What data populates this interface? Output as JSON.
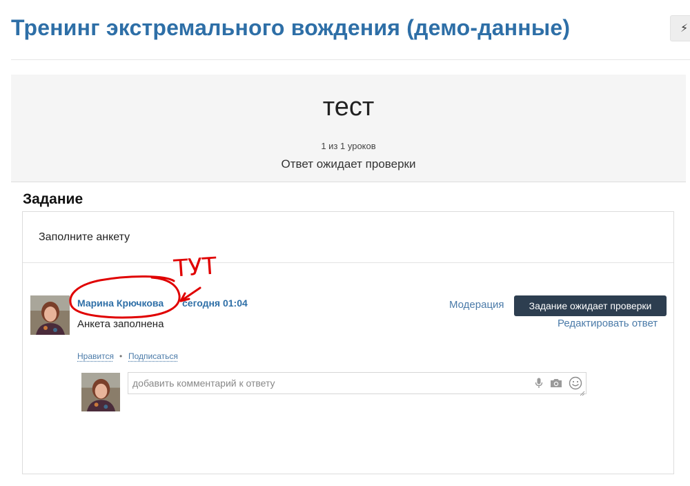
{
  "page": {
    "title": "Тренинг экстремального вождения (демо-данные)",
    "top_button_icon": "lightning-icon"
  },
  "lesson": {
    "title": "тест",
    "progress": "1 из 1 уроков",
    "status": "Ответ ожидает проверки"
  },
  "task": {
    "section_title": "Задание",
    "text": "Заполните анкету"
  },
  "answer": {
    "author": "Марина Крючкова",
    "time": "сегодня 01:04",
    "text": "Анкета заполнена",
    "moderation_label": "Модерация",
    "status_badge": "Задание ожидает проверки",
    "edit_label": "Редактировать ответ",
    "like_label": "Нравится",
    "subscribe_label": "Подписаться",
    "separator": "•"
  },
  "comment": {
    "placeholder": "добавить комментарий к ответу",
    "icons": [
      "mic-icon",
      "camera-icon",
      "smile-icon"
    ]
  },
  "annotation": {
    "text": "ТУТ",
    "color": "#e00000"
  },
  "colors": {
    "title_blue": "#2e6fa7",
    "link_blue": "#4a7aa8",
    "badge_bg": "#2d3e50"
  }
}
